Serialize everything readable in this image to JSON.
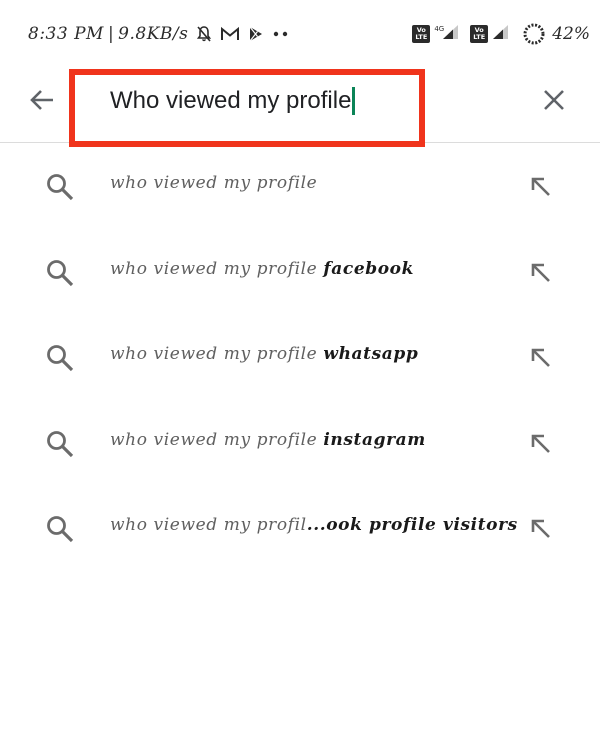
{
  "status_bar": {
    "time": "8:33 PM",
    "separator": "|",
    "net_speed": "9.8KB/s",
    "icons": [
      "mute-notification-icon",
      "gmail-icon",
      "play-store-icon",
      "more-dots-icon"
    ],
    "sim1_volte_top": "Vo",
    "sim1_volte_bottom": "LTE",
    "network_type": "4G",
    "sim2_volte_top": "Vo",
    "sim2_volte_bottom": "LTE",
    "battery": "42%"
  },
  "search": {
    "query": "Who viewed my profile",
    "back_icon": "arrow-back-icon",
    "clear_icon": "close-icon",
    "highlight_color": "#f0341c",
    "cursor_color": "#0b8457"
  },
  "suggestions": [
    {
      "typed": "who viewed my profile",
      "rest": ""
    },
    {
      "typed": "who viewed my profile ",
      "rest": "facebook"
    },
    {
      "typed": "who viewed my profile ",
      "rest": "whatsapp"
    },
    {
      "typed": "who viewed my profile ",
      "rest": "instagram"
    },
    {
      "typed": "who viewed my profil",
      "rest": "...ook profile visitors"
    }
  ]
}
